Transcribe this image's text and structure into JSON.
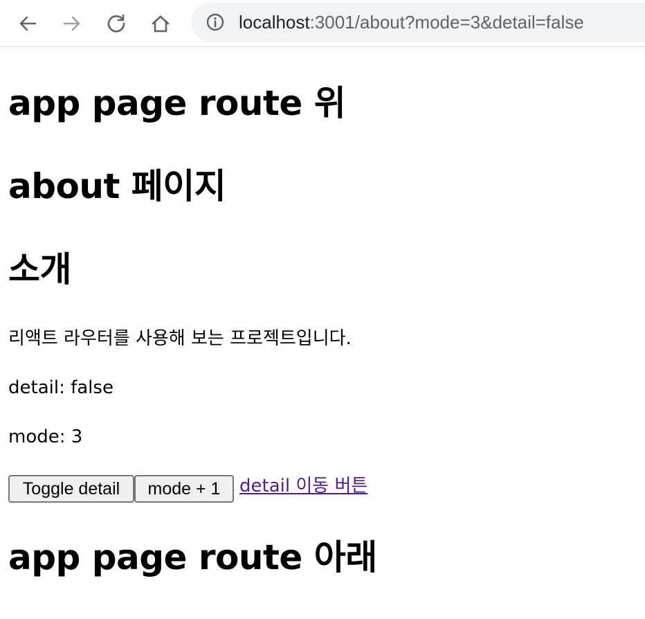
{
  "browser": {
    "url_host": "localhost",
    "url_rest": ":3001/about?mode=3&detail=false"
  },
  "page": {
    "heading_top": "app page route 위",
    "heading_about": "about 페이지",
    "heading_intro": "소개",
    "description": "리액트 라우터를 사용해 보는 프로젝트입니다.",
    "detail_text": "detail: false",
    "mode_text": "mode: 3",
    "toggle_button": "Toggle detail",
    "mode_button": "mode + 1",
    "detail_link": "detail 이동 버튼",
    "heading_bottom": "app page route 아래"
  },
  "colors": {
    "link": "#551a8b",
    "toolbar_icon": "#5f6368",
    "disabled_icon": "#9aa0a6"
  }
}
